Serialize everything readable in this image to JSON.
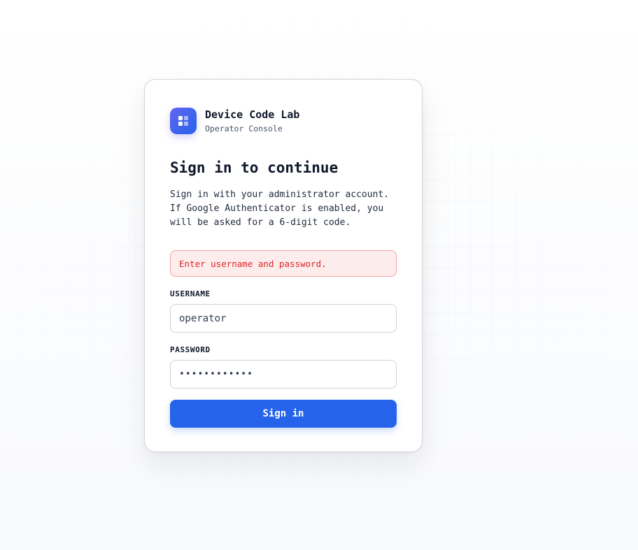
{
  "brand": {
    "name": "Device Code Lab",
    "subtitle": "Operator Console",
    "icon": "grid-logo-icon"
  },
  "form": {
    "title": "Sign in to continue",
    "description": "Sign in with your administrator account. If Google Authenticator is enabled, you will be asked for a 6-digit code.",
    "error": "Enter username and password.",
    "username_label": "USERNAME",
    "username_value": "operator",
    "password_label": "PASSWORD",
    "password_value": "123456789012",
    "submit_label": "Sign in"
  },
  "colors": {
    "accent": "#2563eb",
    "logo_gradient_start": "#6366f1",
    "error_text": "#dc2626",
    "error_bg": "#fdecec",
    "error_border": "#f5a3a3"
  }
}
